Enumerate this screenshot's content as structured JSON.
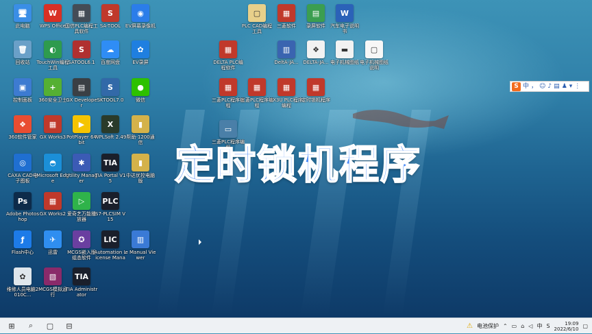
{
  "desktop": {
    "title": "定时锁机程序",
    "icons": [
      {
        "label": "此电脑",
        "glyph": "🖥",
        "color": "#3a8ee6"
      },
      {
        "label": "WPS Office",
        "glyph": "W",
        "color": "#d93025"
      },
      {
        "label": "国信PLC编程工具软件",
        "glyph": "▦",
        "color": "#444c56"
      },
      {
        "label": "SA-TOOL",
        "glyph": "S",
        "color": "#c0392b"
      },
      {
        "label": "EV屏幕录像机",
        "glyph": "◉",
        "color": "#2b7de9"
      },
      {
        "label": "回收站",
        "glyph": "🗑",
        "color": "#6aa0c8"
      },
      {
        "label": "TouchWin编程工具",
        "glyph": "◐",
        "color": "#2e9b4e"
      },
      {
        "label": "SATOOL6.1",
        "glyph": "S",
        "color": "#b03030"
      },
      {
        "label": "百度网盘",
        "glyph": "☁",
        "color": "#2f8df5"
      },
      {
        "label": "EV录屏",
        "glyph": "✿",
        "color": "#1f7fe0"
      },
      {
        "label": "控制面板",
        "glyph": "▣",
        "color": "#3d7bd1"
      },
      {
        "label": "360安全卫士",
        "glyph": "+",
        "color": "#55b032"
      },
      {
        "label": "GX Developer",
        "glyph": "▤",
        "color": "#3a3f44"
      },
      {
        "label": "SKTOOL7.0",
        "glyph": "S",
        "color": "#3269a8"
      },
      {
        "label": "微信",
        "glyph": "●",
        "color": "#2dc100"
      },
      {
        "label": "360软件管家",
        "glyph": "❖",
        "color": "#e94d32"
      },
      {
        "label": "GX Works3",
        "glyph": "▦",
        "color": "#c0392b"
      },
      {
        "label": "PotPlayer 64 bit",
        "glyph": "▶",
        "color": "#f5c400"
      },
      {
        "label": "WPLSoft 2.49",
        "glyph": "X",
        "color": "#2a3b2a"
      },
      {
        "label": "帮助-1200通信",
        "glyph": "▮",
        "color": "#d4b24a"
      },
      {
        "label": "CAXA CAD电子图板",
        "glyph": "◎",
        "color": "#1f6fd1"
      },
      {
        "label": "Microsoft Edge",
        "glyph": "◓",
        "color": "#1b8fd8"
      },
      {
        "label": "Utility Manager",
        "glyph": "✱",
        "color": "#3b5bb5"
      },
      {
        "label": "TIA Portal V15",
        "glyph": "TIA",
        "color": "#1a1f2b"
      },
      {
        "label": "中达优控电脑版",
        "glyph": "▮",
        "color": "#d4b24a"
      },
      {
        "label": "Adobe Photoshop",
        "glyph": "Ps",
        "color": "#0d2b4a"
      },
      {
        "label": "GX Works2",
        "glyph": "▦",
        "color": "#c0392b"
      },
      {
        "label": "爱奇艺万能播放器",
        "glyph": "▷",
        "color": "#2fb34a"
      },
      {
        "label": "S7-PLCSIM V15",
        "glyph": "PLC",
        "color": "#1a1f2b"
      },
      {
        "label": "Flash中心",
        "glyph": "ƒ",
        "color": "#1d7be8"
      },
      {
        "label": "迅雷",
        "glyph": "✈",
        "color": "#2f8ef0"
      },
      {
        "label": "MCGS嵌入版组态软件",
        "glyph": "✪",
        "color": "#6a3fa0"
      },
      {
        "label": "Automation License Manager",
        "glyph": "LIC",
        "color": "#1a1f2b"
      },
      {
        "label": "e Manual Viewer",
        "glyph": "▥",
        "color": "#3a7ad6"
      },
      {
        "label": "维修人员电脑2010C...",
        "glyph": "✿",
        "color": "#dfe6ec"
      },
      {
        "label": "MCGS模拟运行",
        "glyph": "▧",
        "color": "#8a2a6a"
      },
      {
        "label": "TIA Administrator",
        "glyph": "TIA",
        "color": "#1a1f2b"
      },
      {
        "label": "PLC CAD编程工具",
        "glyph": "▢",
        "color": "#e8d08a"
      },
      {
        "label": "三菱软件",
        "glyph": "▦",
        "color": "#c0392b"
      },
      {
        "label": "录屏软件",
        "glyph": "▤",
        "color": "#3b9e50"
      },
      {
        "label": "汽车电子说明书",
        "glyph": "W",
        "color": "#2b62b8"
      },
      {
        "label": "DELTA PLC编程软件",
        "glyph": "▦",
        "color": "#c0392b"
      },
      {
        "label": "DeltA-JA...",
        "glyph": "▥",
        "color": "#3a64b0"
      },
      {
        "label": "DELTA-JA...",
        "glyph": "❖",
        "color": "#f2f2f2"
      },
      {
        "label": "电子机械图纸",
        "glyph": "▬",
        "color": "#f2f2f2"
      },
      {
        "label": "电子机械图纸说明",
        "glyph": "▢",
        "color": "#f7f7f7"
      },
      {
        "label": "三菱PLC程序编程",
        "glyph": "▦",
        "color": "#c0392b"
      },
      {
        "label": "三菱PLC程序编程",
        "glyph": "▦",
        "color": "#c0392b"
      },
      {
        "label": "FX3U PLC程序编程",
        "glyph": "▦",
        "color": "#c0392b"
      },
      {
        "label": "定时锁机程序",
        "glyph": "▦",
        "color": "#c0392b"
      },
      {
        "label": "三菱PLC程序编程",
        "glyph": "▭",
        "color": "#4a7fa8"
      }
    ]
  },
  "ime": {
    "logo": "S",
    "lang": "中",
    "punct": "，"
  },
  "taskbar": {
    "start": "⊞",
    "search": "⌕",
    "taskview": "▢",
    "widgets": "⊟",
    "warning": "电池保护",
    "battery": "▭",
    "network": "⌂",
    "volume": "◁",
    "lang": "中",
    "time": "19:09",
    "date": "2022/6/10"
  }
}
